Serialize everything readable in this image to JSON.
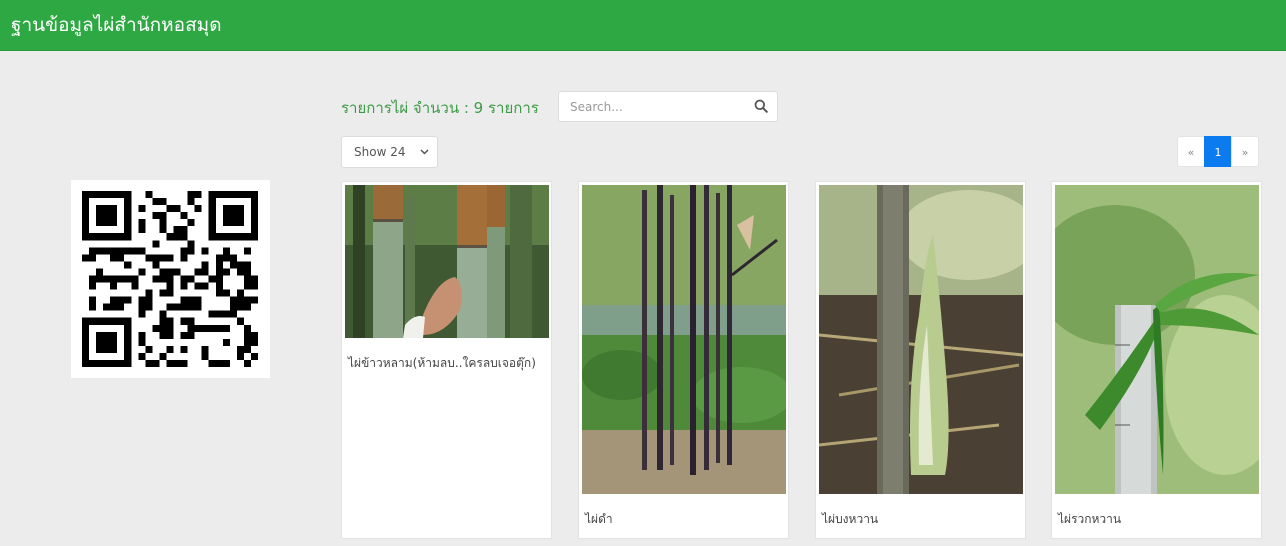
{
  "header": {
    "title": "ฐานข้อมูลไผ่สำนักหอสมุด"
  },
  "toolbar": {
    "count_label": "รายการไผ่ จำนวน : 9 รายการ",
    "search_placeholder": "Search...",
    "show_value": "Show 24"
  },
  "pagination": {
    "prev": "«",
    "current": "1",
    "next": "»"
  },
  "items": [
    {
      "title": "ไผ่ข้าวหลาม(ห้ามลบ..ใครลบเจอตุ๊ก)"
    },
    {
      "title": "ไผ่ดำ"
    },
    {
      "title": "ไผ่บงหวาน"
    },
    {
      "title": "ไผ่รวกหวาน"
    }
  ],
  "colors": {
    "header": "#2ea843",
    "accent_text": "#3c9b45",
    "active_page": "#0d7bf0"
  }
}
